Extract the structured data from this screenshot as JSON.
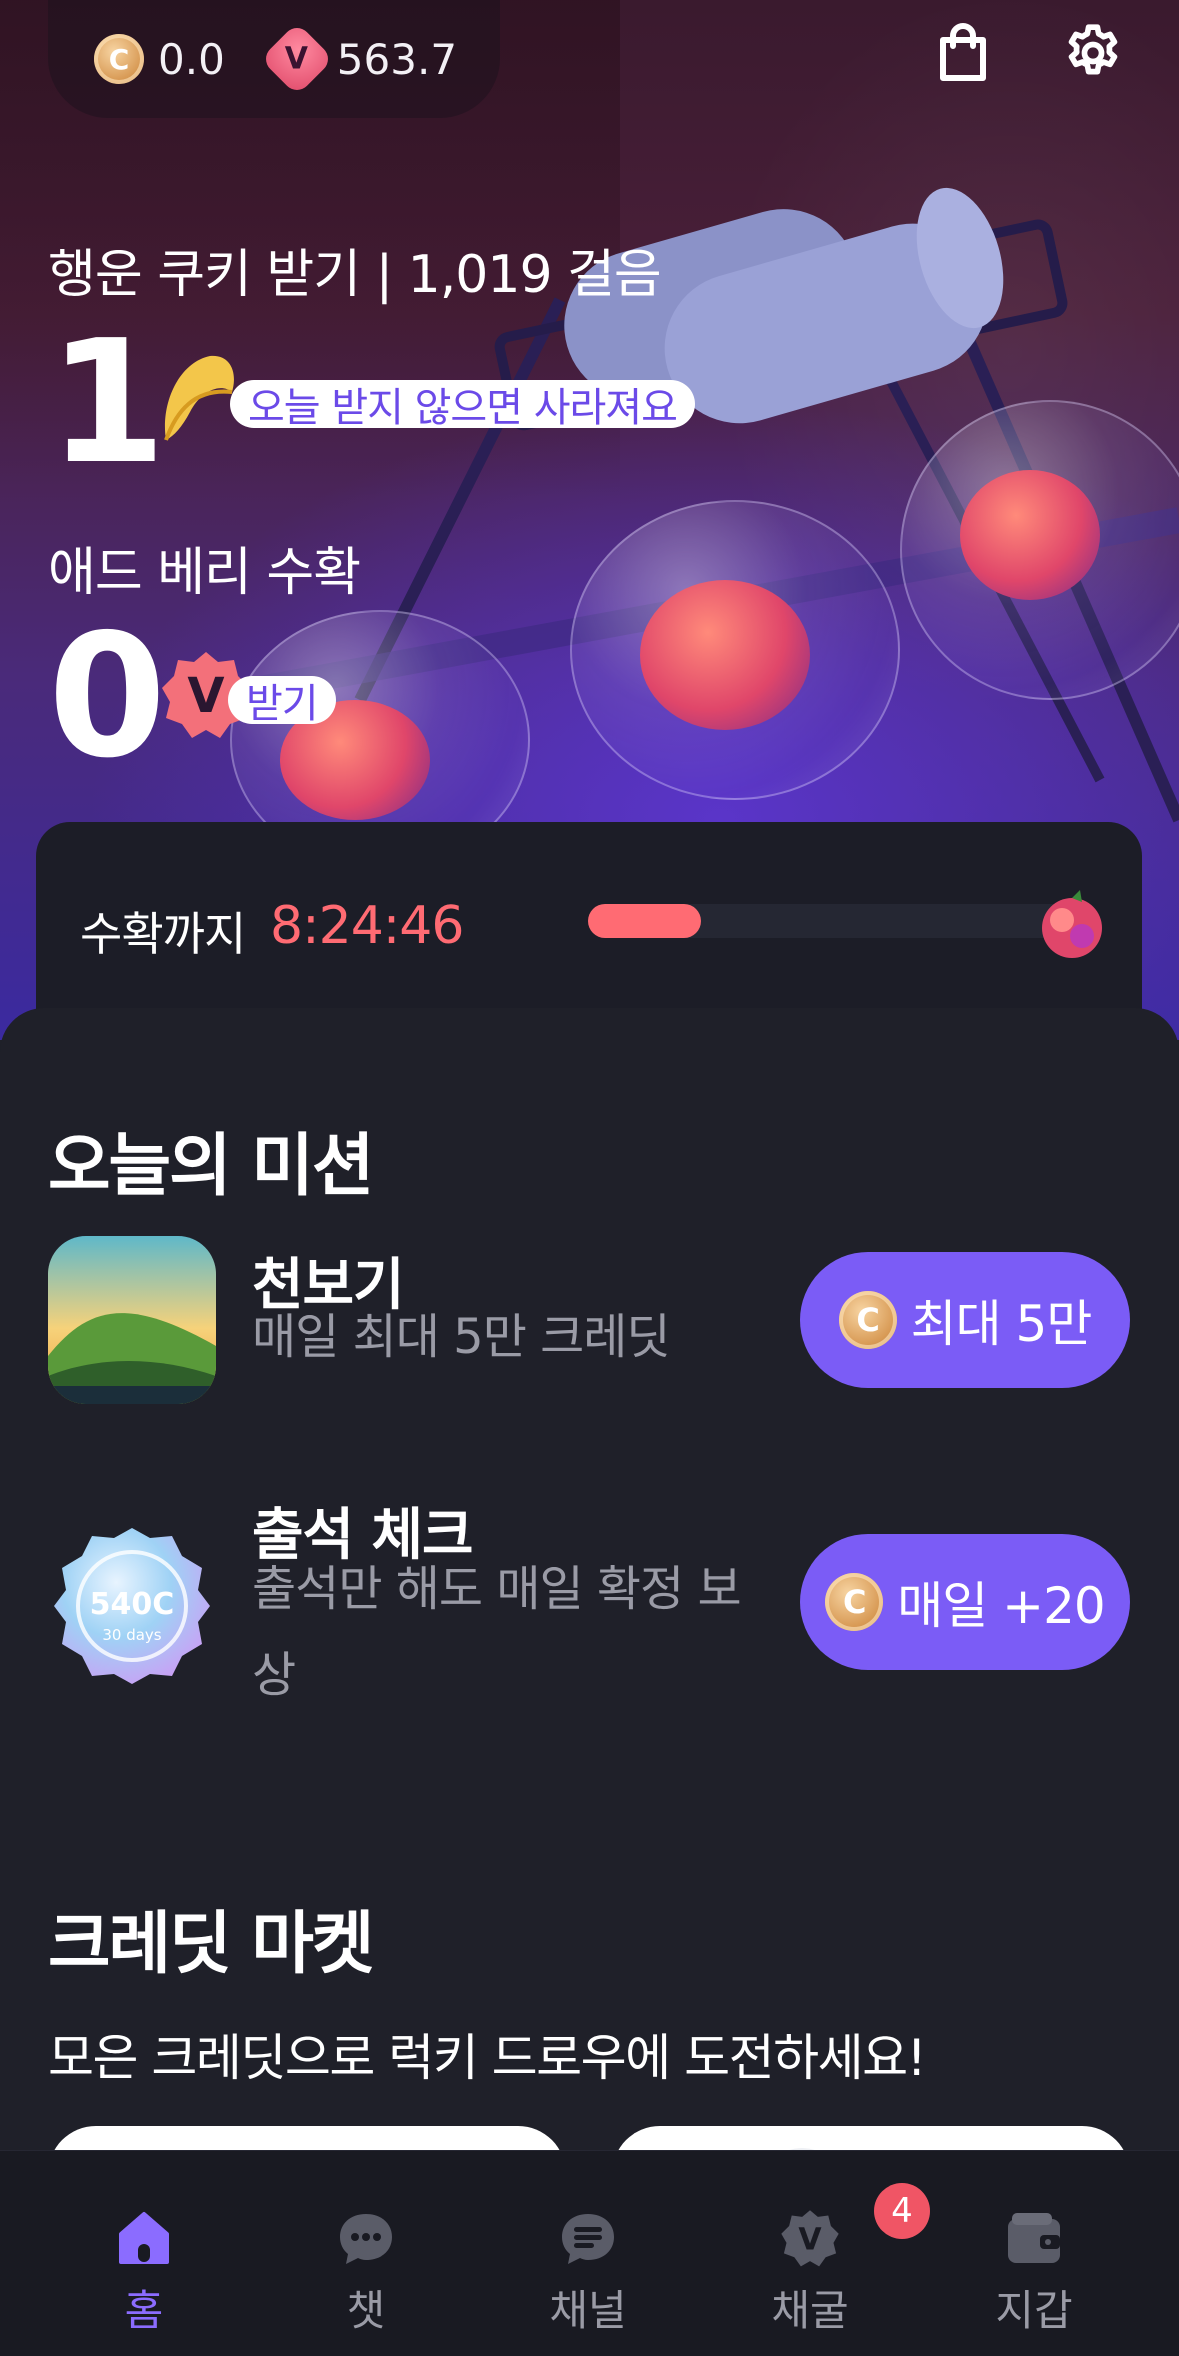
{
  "header": {
    "credit_balance": "0.0",
    "credit_coin_letter": "C",
    "vberry_balance": "563.7",
    "vberry_letter": "V",
    "shop_icon": "shopping-bag-icon",
    "settings_icon": "gear-icon"
  },
  "hero": {
    "cookie_label": "행운 쿠키 받기 | 1,019 걸음",
    "cookie_count": "1",
    "cookie_chip": "오늘 받지 않으면 사라져요",
    "berry_label": "애드 베리 수확",
    "berry_count": "0",
    "berry_chip": "받기",
    "berry_badge_letter": "V"
  },
  "timer": {
    "label": "수확까지",
    "value": "8:24:46",
    "progress_fraction": 0.23,
    "accent": "#ff6b73"
  },
  "missions": {
    "title": "오늘의 미션",
    "items": [
      {
        "title": "천보기",
        "desc": "매일 최대 5만 크레딧",
        "button": "최대 5만"
      },
      {
        "title": "출석 체크",
        "desc": "출석만 해도 매일 확정 보상",
        "button": "매일 +20",
        "badge_main": "540C",
        "badge_sub": "30 days"
      }
    ]
  },
  "market": {
    "title": "크레딧 마켓",
    "subtitle": "모은 크레딧으로 럭키 드로우에 도전하세요!"
  },
  "nav": {
    "items": [
      {
        "label": "홈",
        "icon": "home-icon"
      },
      {
        "label": "챗",
        "icon": "chat-icon"
      },
      {
        "label": "채널",
        "icon": "channel-icon"
      },
      {
        "label": "채굴",
        "icon": "mining-icon",
        "badge": "4"
      },
      {
        "label": "지갑",
        "icon": "wallet-icon"
      }
    ],
    "active_color": "#8b6cff"
  },
  "colors": {
    "accent": "#7b5cf6",
    "background": "#1f2029"
  }
}
